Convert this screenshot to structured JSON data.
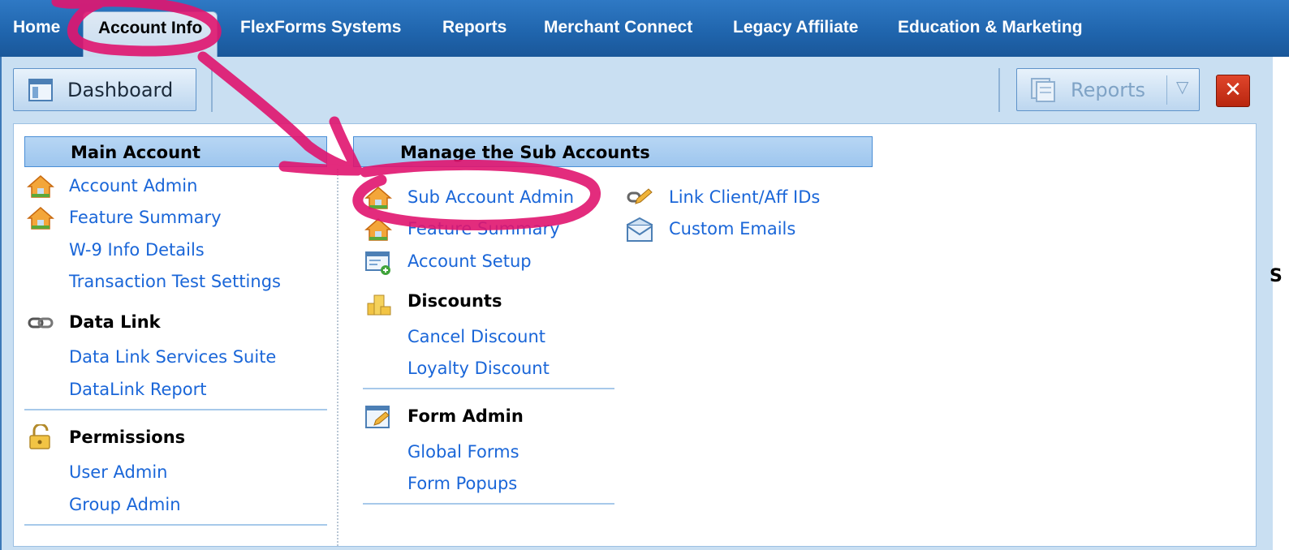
{
  "nav": {
    "tabs": [
      {
        "label": "Home"
      },
      {
        "label": "Account Info"
      },
      {
        "label": "FlexForms Systems"
      },
      {
        "label": "Reports"
      },
      {
        "label": "Merchant Connect"
      },
      {
        "label": "Legacy Affiliate"
      },
      {
        "label": "Education & Marketing"
      }
    ]
  },
  "toolbar": {
    "dashboard_label": "Dashboard",
    "reports_label": "Reports",
    "close_label": "✕"
  },
  "main_account": {
    "header": "Main Account",
    "links": [
      "Account Admin",
      "Feature Summary",
      "W-9 Info Details",
      "Transaction Test Settings"
    ],
    "data_link": {
      "title": "Data Link",
      "links": [
        "Data Link Services Suite",
        "DataLink Report"
      ]
    },
    "permissions": {
      "title": "Permissions",
      "links": [
        "User Admin",
        "Group Admin"
      ]
    }
  },
  "sub_accounts": {
    "header": "Manage the Sub Accounts",
    "links": [
      "Sub Account Admin",
      "Feature Summary",
      "Account Setup"
    ],
    "discounts": {
      "title": "Discounts",
      "links": [
        "Cancel Discount",
        "Loyalty Discount"
      ]
    },
    "form_admin": {
      "title": "Form Admin",
      "links": [
        "Global Forms",
        "Form Popups"
      ]
    },
    "extra_links": [
      "Link Client/Aff IDs",
      "Custom Emails"
    ]
  },
  "edge_char": "S",
  "colors": {
    "nav_bg": "#1f64ac",
    "link": "#1a66d8",
    "annotation": "#e0156f",
    "close_button": "#c8311a"
  }
}
